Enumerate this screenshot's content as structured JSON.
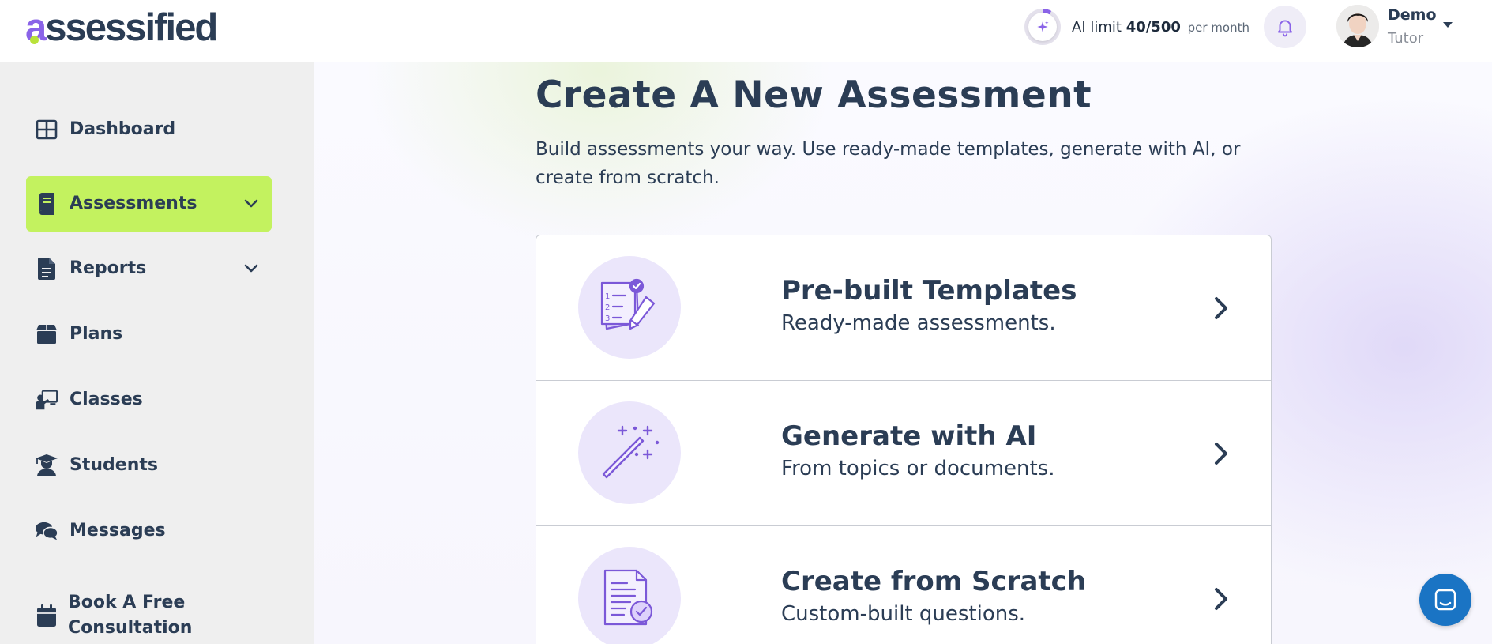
{
  "brand": {
    "logo_text": "assessified",
    "accent": "#8a63e8",
    "lime": "#c3f25f",
    "navy": "#2b3d55"
  },
  "header": {
    "ai_limit_label": "AI limit",
    "ai_limit_value": "40/500",
    "ai_limit_period": "per month",
    "ai_limit_fraction": 0.08,
    "user_name": "Demo",
    "user_role": "Tutor"
  },
  "sidebar": {
    "items": [
      {
        "label": "Dashboard",
        "icon": "grid-icon"
      },
      {
        "label": "Assessments",
        "icon": "book-icon",
        "active": true,
        "expandable": true
      },
      {
        "label": "Reports",
        "icon": "document-icon",
        "expandable": true
      },
      {
        "label": "Plans",
        "icon": "box-icon"
      },
      {
        "label": "Classes",
        "icon": "teacher-board-icon"
      },
      {
        "label": "Students",
        "icon": "graduate-icon"
      },
      {
        "label": "Messages",
        "icon": "chat-bubbles-icon"
      },
      {
        "label": "Book A Free Consultation",
        "icon": "calendar-icon"
      }
    ]
  },
  "main": {
    "title": "Create A New Assessment",
    "subtitle": "Build assessments your way. Use ready-made templates, generate with AI, or create from scratch.",
    "options": [
      {
        "title": "Pre-built Templates",
        "description": "Ready-made assessments.",
        "icon": "checklist-pencil-icon"
      },
      {
        "title": "Generate with AI",
        "description": "From topics or documents.",
        "icon": "magic-wand-icon"
      },
      {
        "title": "Create from Scratch",
        "description": "Custom-built questions.",
        "icon": "document-check-icon"
      }
    ]
  },
  "chat_widget": {
    "icon": "chat-launcher-icon"
  }
}
